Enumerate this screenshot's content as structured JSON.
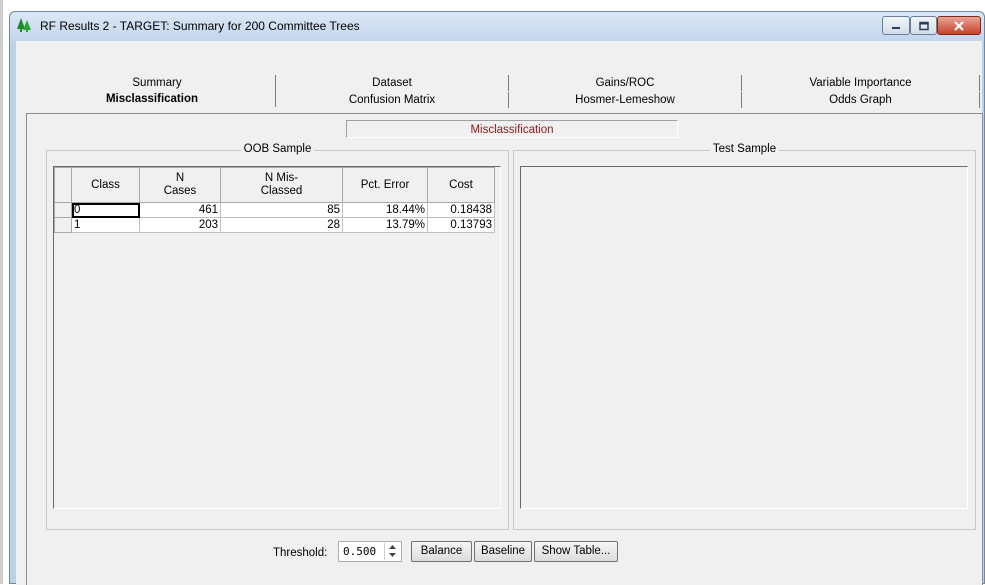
{
  "window": {
    "title": "RF Results 2 - TARGET: Summary for 200 Committee Trees",
    "controls": [
      "minimize-icon",
      "maximize-icon",
      "close-icon"
    ]
  },
  "tabs": {
    "row1": [
      "Summary",
      "Dataset",
      "Gains/ROC",
      "Variable Importance"
    ],
    "row2": [
      "Misclassification",
      "Confusion Matrix",
      "Hosmer-Lemeshow",
      "Odds Graph"
    ],
    "active": "Misclassification"
  },
  "mode_label": "Misclassification",
  "oob": {
    "title": "OOB Sample",
    "columns": [
      "Class",
      "N\nCases",
      "N Mis-\nClassed",
      "Pct. Error",
      "Cost"
    ],
    "rows": [
      {
        "class": "0",
        "n_cases": "461",
        "n_misclassed": "85",
        "pct_error": "18.44%",
        "cost": "0.18438"
      },
      {
        "class": "1",
        "n_cases": "203",
        "n_misclassed": "28",
        "pct_error": "13.79%",
        "cost": "0.13793"
      }
    ]
  },
  "test": {
    "title": "Test Sample"
  },
  "controls": {
    "threshold_label": "Threshold:",
    "threshold_value": "0.500",
    "balance": "Balance",
    "baseline": "Baseline",
    "show_table": "Show Table..."
  },
  "colors": {
    "title_bar": "#c3d6ec",
    "accent_text": "#8b1a1a",
    "close_button": "#c7402a"
  }
}
